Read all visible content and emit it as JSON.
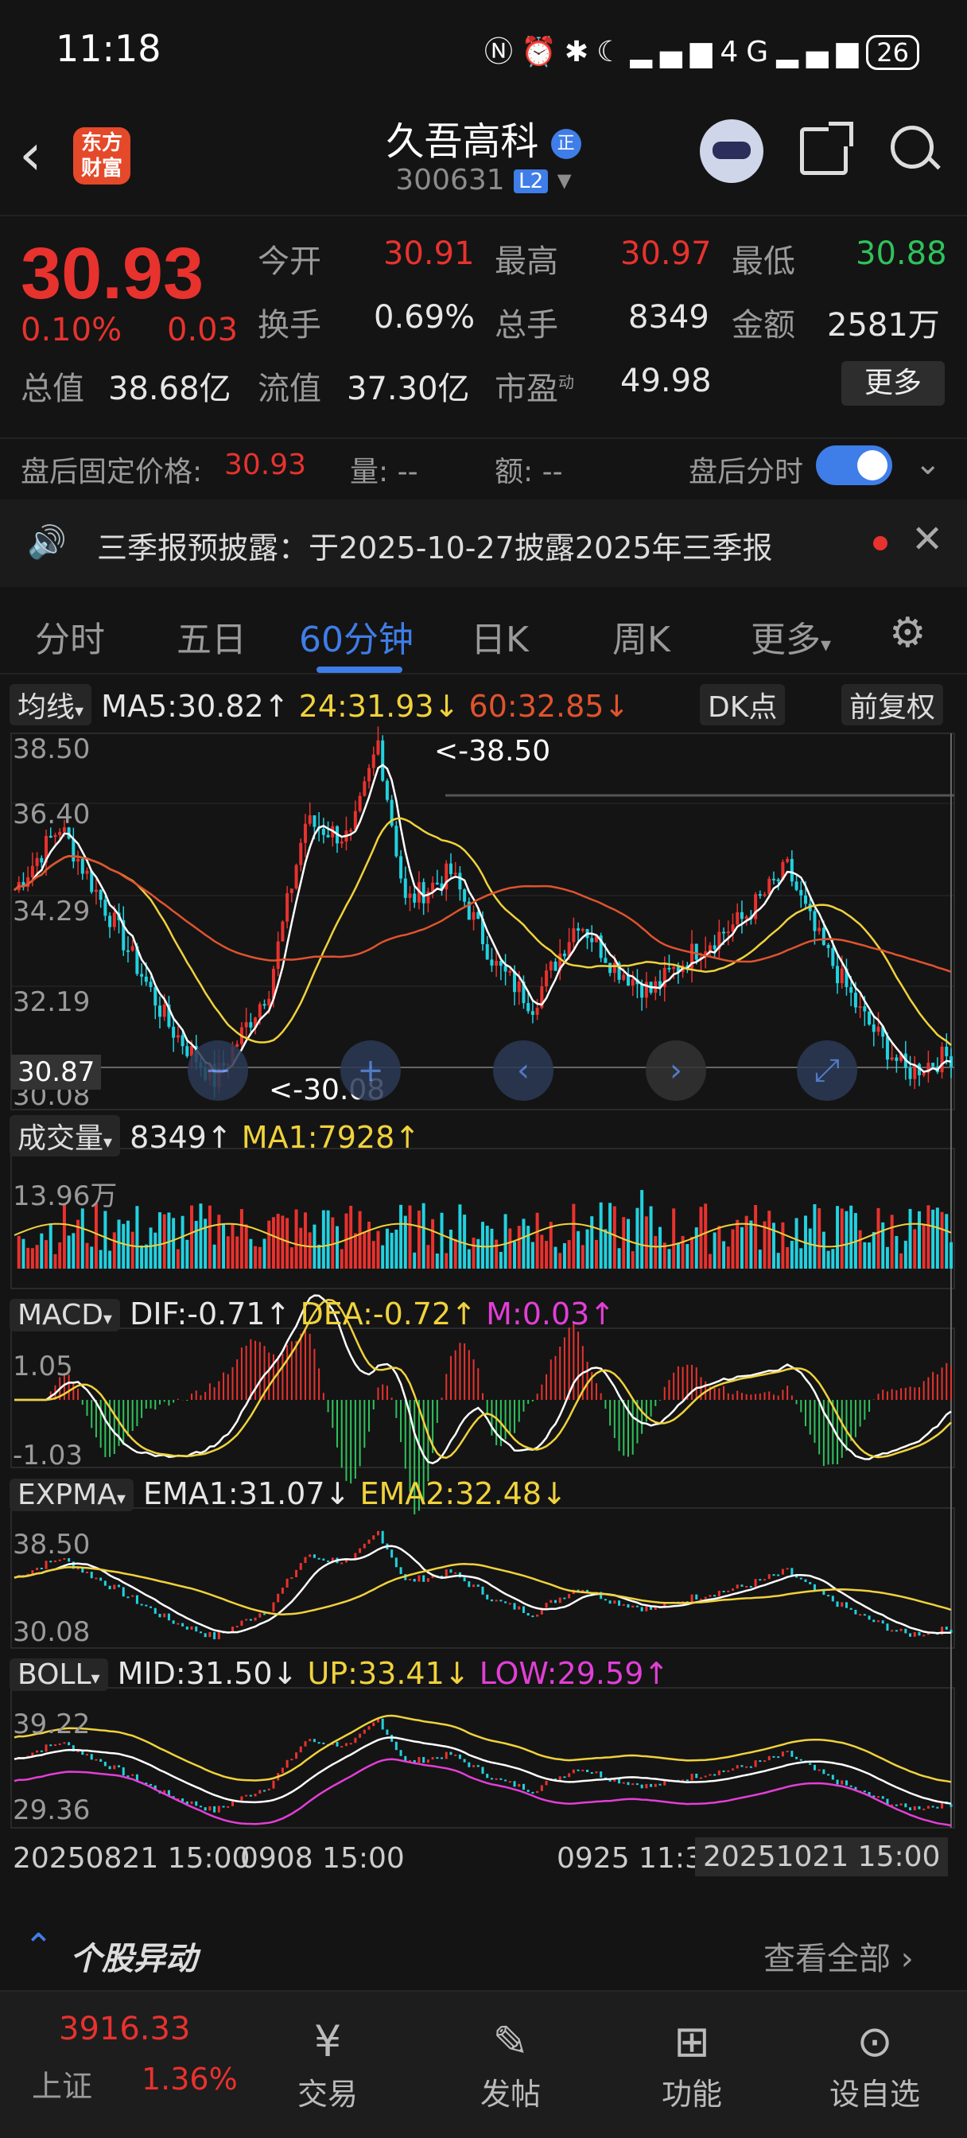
{
  "status_bar": {
    "time": "11:18",
    "signal": "4G",
    "battery": "26"
  },
  "header": {
    "logo_text": "东方财富",
    "stock_name": "久吾高科",
    "badge": "正",
    "code": "300631",
    "level": "L2"
  },
  "quote": {
    "price": "30.93",
    "change_pct": "0.10%",
    "change_amt": "0.03",
    "open_label": "今开",
    "open": "30.91",
    "high_label": "最高",
    "high": "30.97",
    "low_label": "最低",
    "low": "30.88",
    "turnover_label": "换手",
    "turnover": "0.69%",
    "volume_label": "总手",
    "volume": "8349",
    "amount_label": "金额",
    "amount": "2581万",
    "mktcap_label": "总值",
    "mktcap": "38.68亿",
    "float_label": "流值",
    "float": "37.30亿",
    "pe_label": "市盈",
    "pe_sup": "动",
    "pe": "49.98",
    "more_label": "更多"
  },
  "after_hours": {
    "label": "盘后固定价格:",
    "price": "30.93",
    "vol_label": "量: --",
    "amt_label": "额: --",
    "toggle_label": "盘后分时"
  },
  "notice": {
    "text": "三季报预披露：于2025-10-27披露2025年三季报"
  },
  "tabs": [
    {
      "label": "分时"
    },
    {
      "label": "五日"
    },
    {
      "label": "60分钟"
    },
    {
      "label": "日K"
    },
    {
      "label": "周K"
    },
    {
      "label": "更多"
    }
  ],
  "ma_row": {
    "selector": "均线",
    "ma5": "MA5:30.82↑",
    "ma24": "24:31.93↓",
    "ma60": "60:32.85↓",
    "dk": "DK点",
    "adjust": "前复权"
  },
  "main_chart": {
    "y_labels": [
      "38.50",
      "36.40",
      "34.29",
      "32.19",
      "30.08"
    ],
    "high_mark": "<-38.50",
    "low_mark": "<-30.08",
    "crosshair": "30.87"
  },
  "volume_row": {
    "selector": "成交量",
    "vol": "8349↑",
    "ma1": "MA1:7928↑",
    "y_label": "13.96万"
  },
  "macd_row": {
    "selector": "MACD",
    "dif": "DIF:-0.71↑",
    "dea": "DEA:-0.72↑",
    "m": "M:0.03↑",
    "y_top": "1.05",
    "y_bot": "-1.03"
  },
  "expma_row": {
    "selector": "EXPMA",
    "ema1": "EMA1:31.07↓",
    "ema2": "EMA2:32.48↓",
    "y_top": "38.50",
    "y_bot": "30.08"
  },
  "boll_row": {
    "selector": "BOLL",
    "mid": "MID:31.50↓",
    "up": "UP:33.41↓",
    "low": "LOW:29.59↑",
    "y_top": "39.22",
    "y_bot": "29.36"
  },
  "x_axis": {
    "left": "20250821 15:00",
    "mid1": "0908 15:00",
    "mid2": "0925 11:3",
    "right": "20251021 15:00"
  },
  "movers": {
    "title": "个股异动",
    "link": "查看全部"
  },
  "bottom_nav": {
    "index_value": "3916.33",
    "index_name": "上证",
    "index_change": "1.36%",
    "items": [
      {
        "label": "交易"
      },
      {
        "label": "发帖"
      },
      {
        "label": "功能"
      },
      {
        "label": "设自选"
      }
    ]
  },
  "colors": {
    "up": "#e8322e",
    "down": "#2fc25b",
    "accent": "#3f7de8",
    "ma5": "#ffffff",
    "ma24": "#f0d23c",
    "ma60": "#e0532e"
  }
}
